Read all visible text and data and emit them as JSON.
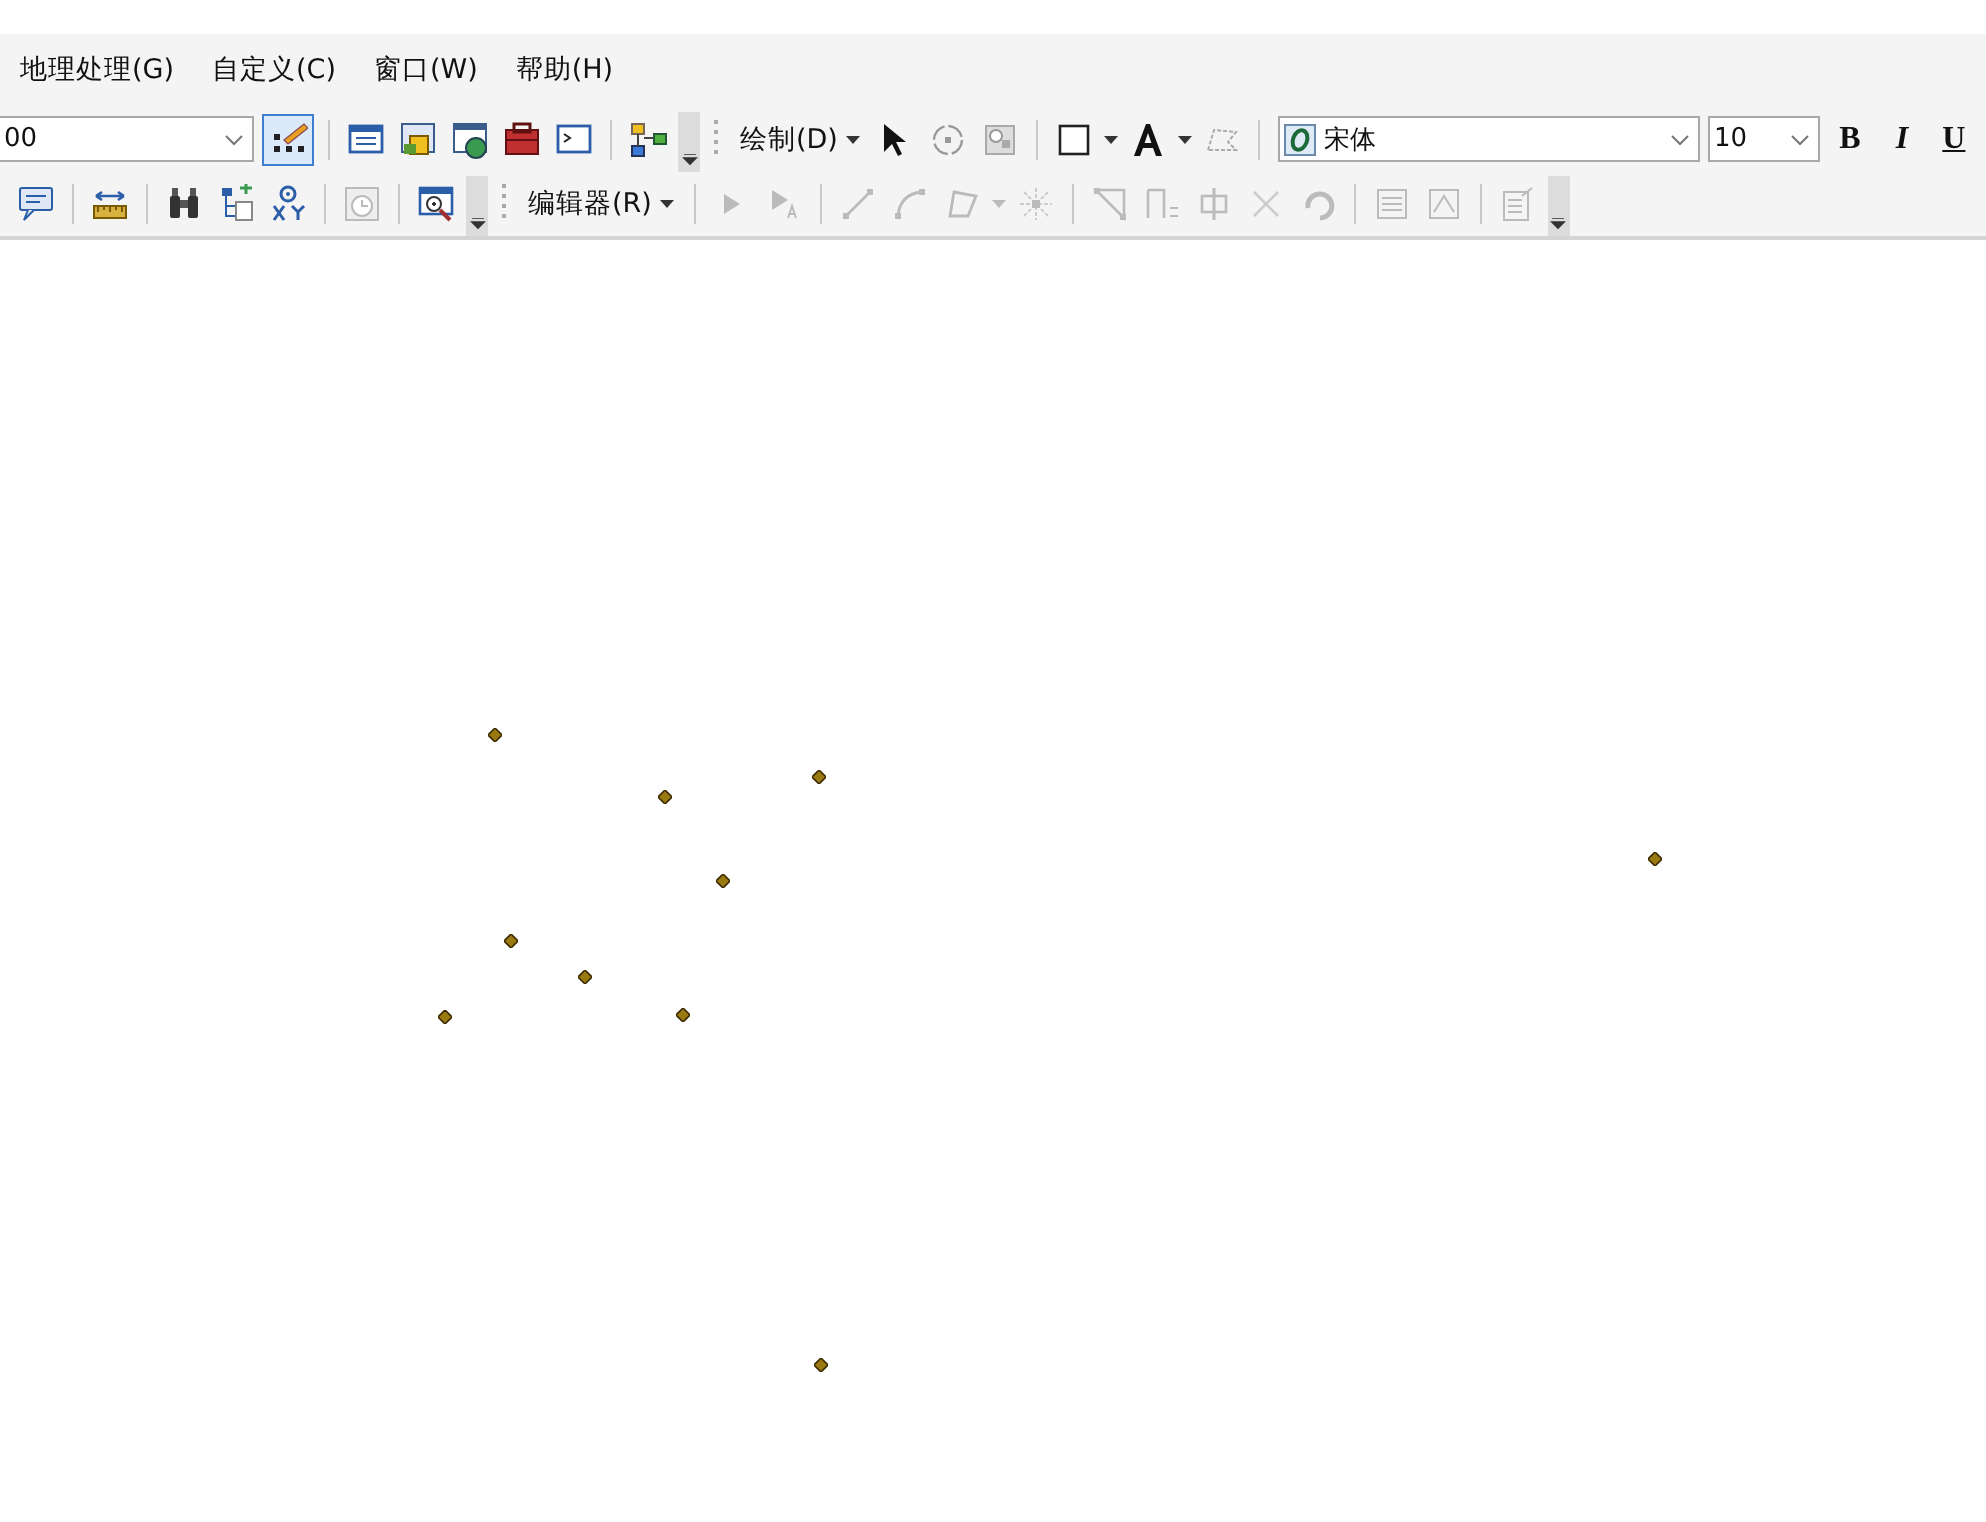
{
  "menu": [
    {
      "label": "地理处理(G)"
    },
    {
      "label": "自定义(C)"
    },
    {
      "label": "窗口(W)"
    },
    {
      "label": "帮助(H)"
    }
  ],
  "standard_toolbar": {
    "scale_field": {
      "value": "00"
    },
    "edit_tool": {
      "selected": true
    }
  },
  "draw_toolbar": {
    "label": "绘制(D)",
    "font_field": {
      "value": "宋体"
    },
    "size_field": {
      "value": "10"
    },
    "style_buttons": [
      "B",
      "I",
      "U"
    ]
  },
  "editor_toolbar": {
    "label": "编辑器(R)",
    "disabled": true
  }
}
